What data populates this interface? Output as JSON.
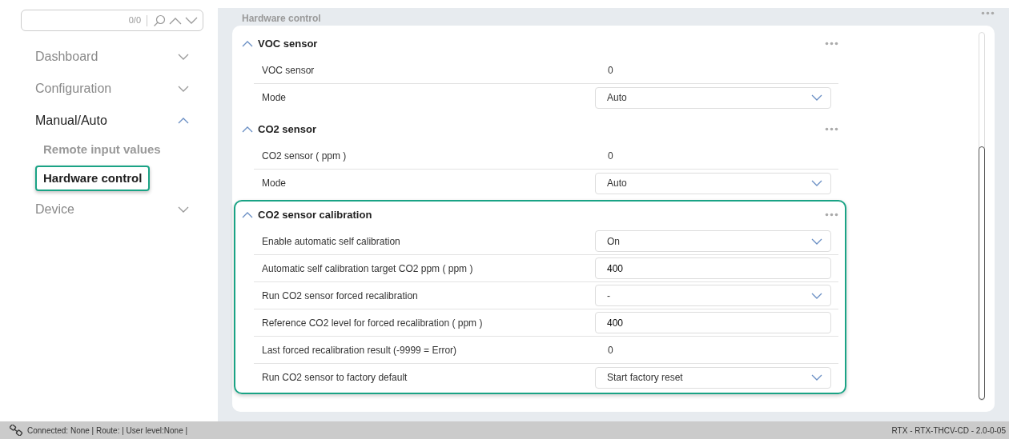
{
  "search": {
    "count": "0/0"
  },
  "sidebar": {
    "items": [
      {
        "label": "Dashboard",
        "expanded": false
      },
      {
        "label": "Configuration",
        "expanded": false
      },
      {
        "label": "Manual/Auto",
        "expanded": true,
        "children": [
          {
            "label": "Remote input values",
            "selected": false
          },
          {
            "label": "Hardware control",
            "selected": true
          }
        ]
      },
      {
        "label": "Device",
        "expanded": false
      }
    ]
  },
  "page_title": "Hardware control",
  "sections": [
    {
      "title": "VOC sensor",
      "expanded": true,
      "highlighted": false,
      "rows": [
        {
          "kind": "value",
          "label": "VOC sensor",
          "value": "0"
        },
        {
          "kind": "select",
          "label": "Mode",
          "value": "Auto"
        }
      ]
    },
    {
      "title": "CO2 sensor",
      "expanded": true,
      "highlighted": false,
      "rows": [
        {
          "kind": "value",
          "label": "CO2 sensor ( ppm )",
          "value": "0"
        },
        {
          "kind": "select",
          "label": "Mode",
          "value": "Auto"
        }
      ]
    },
    {
      "title": "CO2 sensor calibration",
      "expanded": true,
      "highlighted": true,
      "rows": [
        {
          "kind": "select",
          "label": "Enable automatic self calibration",
          "value": "On"
        },
        {
          "kind": "input",
          "label": "Automatic self calibration target CO2 ppm ( ppm )",
          "value": "400"
        },
        {
          "kind": "select",
          "label": "Run CO2 sensor forced recalibration",
          "value": "-"
        },
        {
          "kind": "input",
          "label": "Reference CO2 level for forced recalibration ( ppm )",
          "value": "400"
        },
        {
          "kind": "value",
          "label": "Last forced recalibration result (-9999 = Error)",
          "value": "0"
        },
        {
          "kind": "select",
          "label": "Run CO2 sensor to factory default",
          "value": "Start factory reset"
        }
      ]
    }
  ],
  "status_bar": {
    "left": "Connected: None | Route: | User level:None |",
    "right": "RTX - RTX-THCV-CD - 2.0-0-05"
  }
}
